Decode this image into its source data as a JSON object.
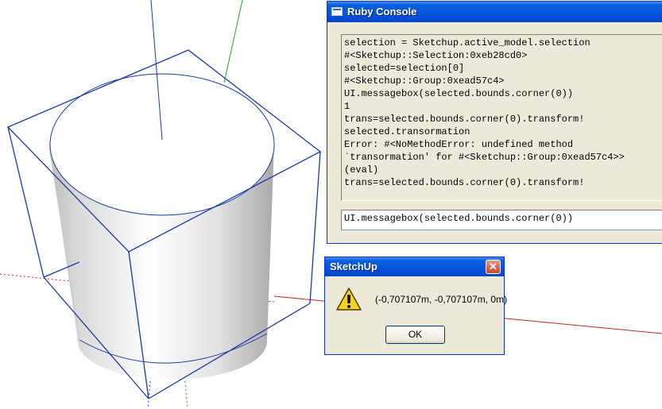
{
  "ruby_console": {
    "title": "Ruby Console",
    "output_lines": [
      "selection = Sketchup.active_model.selection",
      "#<Sketchup::Selection:0xeb28cd0>",
      "selected=selection[0]",
      "#<Sketchup::Group:0xead57c4>",
      "UI.messagebox(selected.bounds.corner(0))",
      "1",
      "trans=selected.bounds.corner(0).transform!",
      "selected.transormation",
      "Error: #<NoMethodError: undefined method",
      "`transormation' for #<Sketchup::Group:0xead57c4>>",
      "(eval)",
      "trans=selected.bounds.corner(0).transform!"
    ],
    "input_value": "UI.messagebox(selected.bounds.corner(0))"
  },
  "message_dialog": {
    "title": "SketchUp",
    "close_glyph": "✕",
    "icon": "warning-icon",
    "message": "(-0,707107m, -0,707107m, 0m)",
    "ok_label": "OK"
  },
  "colors": {
    "bounding_box": "#1a3aa8",
    "green_axis": "#22aa22",
    "red_axis": "#cc2222",
    "title_bar": "#0554e0"
  }
}
